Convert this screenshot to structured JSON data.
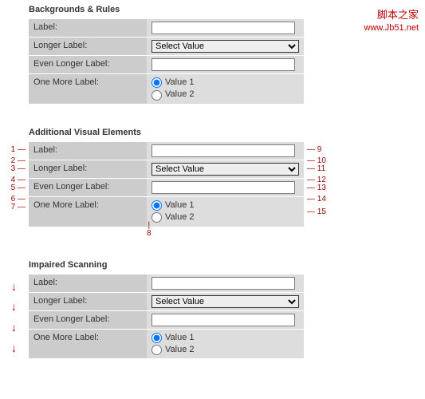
{
  "watermark": {
    "cn": "脚本之家",
    "url": "www.Jb51.net"
  },
  "section1": {
    "title": "Backgrounds & Rules",
    "row1_label": "Label:",
    "row2_label": "Longer Label:",
    "row3_label": "Even Longer Label:",
    "row4_label": "One More Label:",
    "select_value": "Select Value",
    "radio1": "Value 1",
    "radio2": "Value 2"
  },
  "section2": {
    "title": "Additional Visual Elements",
    "row1_label": "Label:",
    "row2_label": "Longer Label:",
    "row3_label": "Even Longer Label:",
    "row4_label": "One More Label:",
    "select_value": "Select Value",
    "radio1": "Value 1",
    "radio2": "Value 2",
    "callouts_left": [
      "1",
      "2",
      "3",
      "4",
      "5",
      "6",
      "7"
    ],
    "callouts_right": [
      "9",
      "10",
      "11",
      "12",
      "13",
      "14",
      "15"
    ],
    "callout_bottom": "8"
  },
  "section3": {
    "title": "Impaired Scanning",
    "row1_label": "Label:",
    "row2_label": "Longer Label:",
    "row3_label": "Even Longer Label:",
    "row4_label": "One More Label:",
    "select_value": "Select Value",
    "radio1": "Value 1",
    "radio2": "Value 2",
    "arrow": "↓"
  }
}
